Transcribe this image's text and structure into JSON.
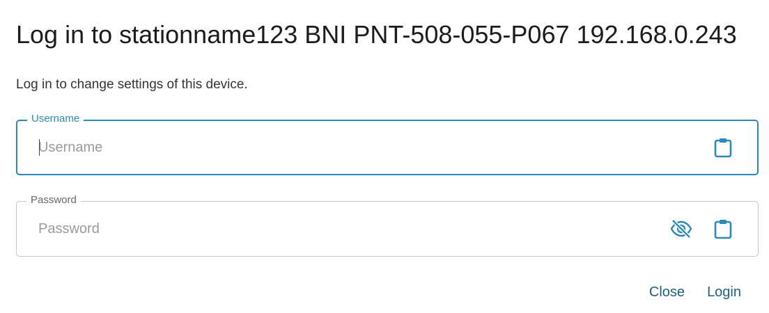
{
  "dialog": {
    "title": "Log in to stationname123 BNI PNT-508-055-P067 192.168.0.243",
    "subtitle": "Log in to change settings of this device."
  },
  "username": {
    "label": "Username",
    "placeholder": "Username",
    "value": "",
    "paste_icon": "clipboard-icon"
  },
  "password": {
    "label": "Password",
    "placeholder": "Password",
    "value": "",
    "visibility_icon": "eye-off-icon",
    "paste_icon": "clipboard-icon"
  },
  "actions": {
    "close_label": "Close",
    "login_label": "Login"
  },
  "colors": {
    "accent": "#2a8ab7",
    "button_text": "#1d5f80",
    "idle_border": "#c4c4c4"
  }
}
